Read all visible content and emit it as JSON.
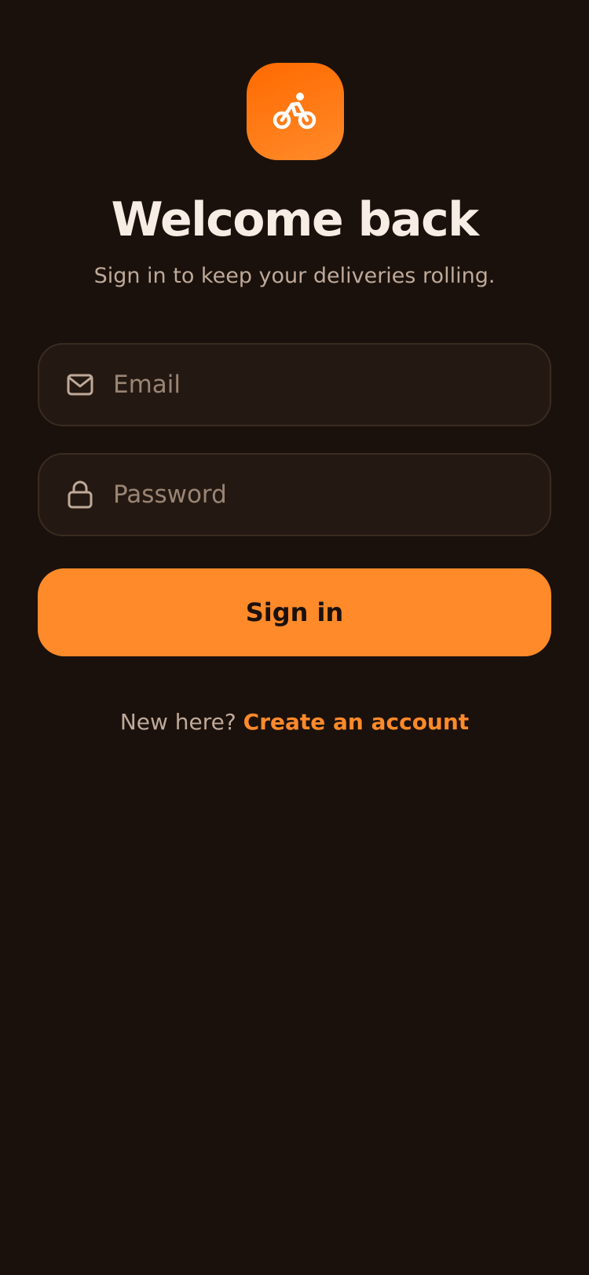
{
  "brand": {
    "icon": "bicycle-rider-icon",
    "accent_color": "#ff8a2a",
    "background_color": "#1a110c"
  },
  "header": {
    "title": "Welcome back",
    "subtitle": "Sign in to keep your deliveries rolling."
  },
  "form": {
    "email": {
      "icon": "mail-icon",
      "placeholder": "Email",
      "value": ""
    },
    "password": {
      "icon": "lock-icon",
      "placeholder": "Password",
      "value": ""
    },
    "submit_label": "Sign in"
  },
  "footer": {
    "prompt": "New here?",
    "link_label": "Create an account"
  }
}
